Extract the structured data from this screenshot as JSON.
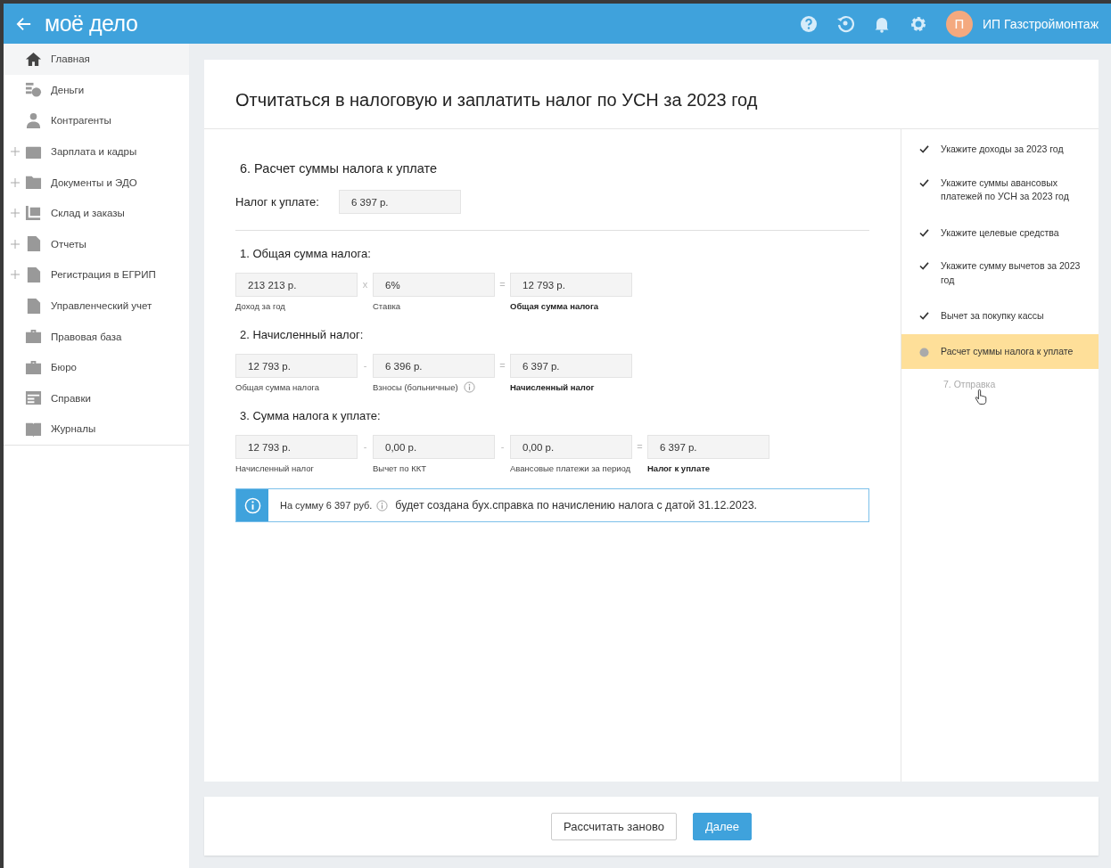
{
  "header": {
    "logo": "моё дело",
    "user": {
      "initial": "П",
      "name": "ИП Газстроймонтаж"
    }
  },
  "sidebar": {
    "items": [
      {
        "label": "Главная",
        "expandable": false,
        "selected": true
      },
      {
        "label": "Деньги",
        "expandable": false,
        "selected": false
      },
      {
        "label": "Контрагенты",
        "expandable": false,
        "selected": false
      },
      {
        "label": "Зарплата и кадры",
        "expandable": true,
        "selected": false
      },
      {
        "label": "Документы и ЭДО",
        "expandable": true,
        "selected": false
      },
      {
        "label": "Склад и заказы",
        "expandable": true,
        "selected": false
      },
      {
        "label": "Отчеты",
        "expandable": true,
        "selected": false
      },
      {
        "label": "Регистрация в ЕГРИП",
        "expandable": true,
        "selected": false
      },
      {
        "label": "Управленческий учет",
        "expandable": false,
        "selected": false
      },
      {
        "label": "Правовая база",
        "expandable": false,
        "selected": false
      },
      {
        "label": "Бюро",
        "expandable": false,
        "selected": false
      },
      {
        "label": "Справки",
        "expandable": false,
        "selected": false
      },
      {
        "label": "Журналы",
        "expandable": false,
        "selected": false
      }
    ]
  },
  "page": {
    "title": "Отчитаться в налоговую и заплатить налог по УСН за 2023 год",
    "section_title": "6. Расчет суммы налога к уплате",
    "tax_label": "Налог к уплате:",
    "tax_value": "6 397 р."
  },
  "groups": [
    {
      "title": "1. Общая сумма налога:",
      "fields": [
        {
          "value": "213 213 р.",
          "caption": "Доход за год",
          "bold": false,
          "info": false
        },
        {
          "operator": "x",
          "value": "6%",
          "caption": "Ставка",
          "bold": false,
          "info": false
        },
        {
          "operator": "=",
          "value": "12 793 р.",
          "caption": "Общая сумма налога",
          "bold": true,
          "info": false
        }
      ]
    },
    {
      "title": "2. Начисленный налог:",
      "fields": [
        {
          "value": "12 793 р.",
          "caption": "Общая сумма налога",
          "bold": false,
          "info": false
        },
        {
          "operator": "-",
          "value": "6 396 р.",
          "caption": "Взносы (больничные)",
          "bold": false,
          "info": true
        },
        {
          "operator": "=",
          "value": "6 397 р.",
          "caption": "Начисленный налог",
          "bold": true,
          "info": false
        }
      ]
    },
    {
      "title": "3. Сумма налога к уплате:",
      "fields": [
        {
          "value": "12 793 р.",
          "caption": "Начисленный налог",
          "bold": false,
          "info": false
        },
        {
          "operator": "-",
          "value": "0,00 р.",
          "caption": "Вычет по ККТ",
          "bold": false,
          "info": false
        },
        {
          "operator": "-",
          "value": "0,00 р.",
          "caption": "Авансовые платежи за период",
          "bold": false,
          "info": false
        },
        {
          "operator": "=",
          "value": "6 397 р.",
          "caption": "Налог к уплате",
          "bold": true,
          "info": false
        }
      ]
    }
  ],
  "notice": {
    "amount": "На сумму 6 397 руб.",
    "text": "будет создана бух.справка по начислению налога с датой 31.12.2023."
  },
  "steps": [
    {
      "label": "Укажите доходы за 2023 год",
      "kind": "done"
    },
    {
      "label": "Укажите суммы авансовых платежей по УСН за 2023 год",
      "kind": "done"
    },
    {
      "label": "Укажите целевые средства",
      "kind": "done"
    },
    {
      "label": "Укажите сумму вычетов за 2023 год",
      "kind": "done"
    },
    {
      "label": "Вычет за покупку кассы",
      "kind": "done"
    },
    {
      "label": "Расчет суммы налога к уплате",
      "kind": "current"
    },
    {
      "label": "7. Отправка",
      "kind": "pending"
    }
  ],
  "buttons": {
    "secondary": "Рассчитать заново",
    "primary": "Далее"
  }
}
